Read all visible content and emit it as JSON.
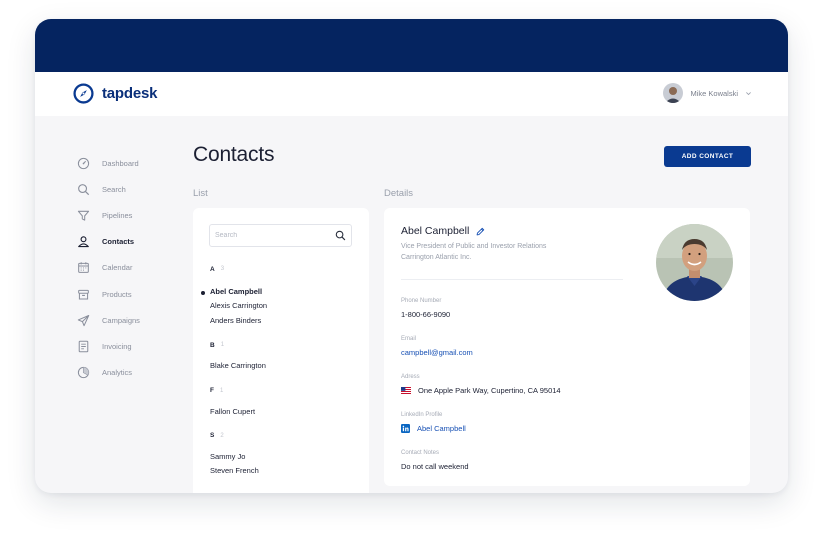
{
  "app": {
    "name": "tapdesk"
  },
  "user": {
    "name": "Mike Kowalski"
  },
  "sidebar": {
    "items": [
      {
        "label": "Dashboard",
        "icon": "gauge-icon",
        "active": false
      },
      {
        "label": "Search",
        "icon": "search-icon",
        "active": false
      },
      {
        "label": "Pipelines",
        "icon": "filter-icon",
        "active": false
      },
      {
        "label": "Contacts",
        "icon": "contacts-icon",
        "active": true
      },
      {
        "label": "Calendar",
        "icon": "calendar-icon",
        "active": false
      },
      {
        "label": "Products",
        "icon": "box-icon",
        "active": false
      },
      {
        "label": "Campaigns",
        "icon": "send-icon",
        "active": false
      },
      {
        "label": "Invoicing",
        "icon": "document-icon",
        "active": false
      },
      {
        "label": "Analytics",
        "icon": "pie-chart-icon",
        "active": false
      }
    ]
  },
  "page": {
    "title": "Contacts",
    "add_button": "ADD CONTACT",
    "list_label": "List",
    "details_label": "Details"
  },
  "list": {
    "search_placeholder": "Search",
    "groups": [
      {
        "letter": "A",
        "count": "3",
        "contacts": [
          "Abel Campbell",
          "Alexis Carrington",
          "Anders Binders"
        ]
      },
      {
        "letter": "B",
        "count": "1",
        "contacts": [
          "Blake Carrington"
        ]
      },
      {
        "letter": "F",
        "count": "1",
        "contacts": [
          "Fallon Cupert"
        ]
      },
      {
        "letter": "S",
        "count": "2",
        "contacts": [
          "Sammy Jo",
          "Steven French"
        ]
      }
    ],
    "selected": "Abel Campbell"
  },
  "details": {
    "name": "Abel Campbell",
    "title": "Vice President of Public and Investor Relations Carrington Atlantic Inc.",
    "phone_label": "Phone Number",
    "phone": "1-800-66-9090",
    "email_label": "Email",
    "email": "campbell@gmail.com",
    "address_label": "Adress",
    "address": "One Apple Park Way, Cupertino, CA 95014",
    "linkedin_label": "LinkedIn Profile",
    "linkedin": "Abel Campbell",
    "notes_label": "Contact Notes",
    "notes": "Do not call weekend"
  },
  "colors": {
    "top_band": "#052460",
    "brand": "#0a2f7a",
    "primary_button": "#0a3a91",
    "link": "#1750b4",
    "background": "#f6f6f8"
  }
}
